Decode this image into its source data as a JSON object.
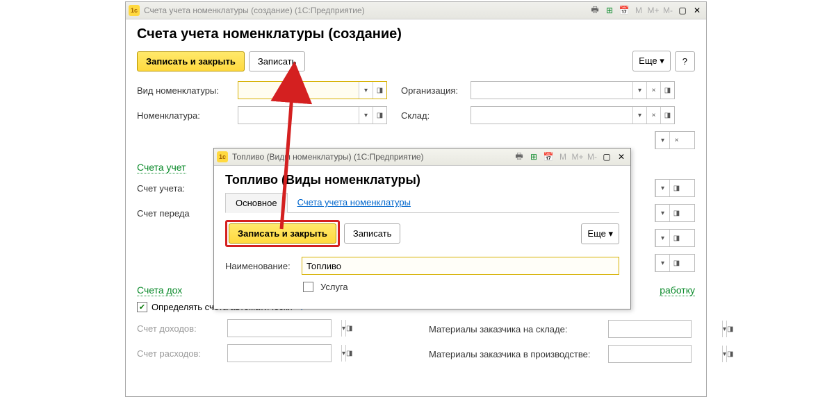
{
  "mainWindow": {
    "title": "Счета учета номенклатуры (создание)  (1С:Предприятие)",
    "pageTitle": "Счета учета номенклатуры (создание)",
    "toolbar": {
      "saveClose": "Записать и закрыть",
      "save": "Записать",
      "more": "Еще",
      "help": "?"
    },
    "fields": {
      "vidNomen": "Вид номенклатуры:",
      "org": "Организация:",
      "nomen": "Номенклатура:",
      "sklad": "Склад:"
    },
    "sections": {
      "uchet": "Счета учет",
      "dohod": "Счета дох",
      "rabotku": "работку"
    },
    "uchetFields": {
      "schet": "Счет учета:",
      "peredacha": "Счет переда"
    },
    "autoCheck": "Определять счета автоматически",
    "dohodFields": {
      "dohod": "Счет доходов:",
      "rashod": "Счет расходов:"
    },
    "rightFields": {
      "mat1": "Материалы заказчика на складе:",
      "mat2": "Материалы заказчика в производстве:"
    }
  },
  "dialog": {
    "title": "Топливо (Виды номенклатуры)  (1С:Предприятие)",
    "pageTitle": "Топливо (Виды номенклатуры)",
    "tabs": {
      "main": "Основное",
      "accounts": "Счета учета номенклатуры"
    },
    "toolbar": {
      "saveClose": "Записать и закрыть",
      "save": "Записать",
      "more": "Еще"
    },
    "nameLabel": "Наименование:",
    "nameValue": "Топливо",
    "serviceLabel": "Услуга"
  },
  "titleTools": {
    "m": "M",
    "mplus": "M+",
    "mminus": "M-"
  },
  "icons": {
    "dropdown": "▾",
    "clear": "×",
    "open": "◨",
    "check": "✔",
    "minimize": "▢",
    "close": "✕",
    "moreArrow": " ▾"
  }
}
